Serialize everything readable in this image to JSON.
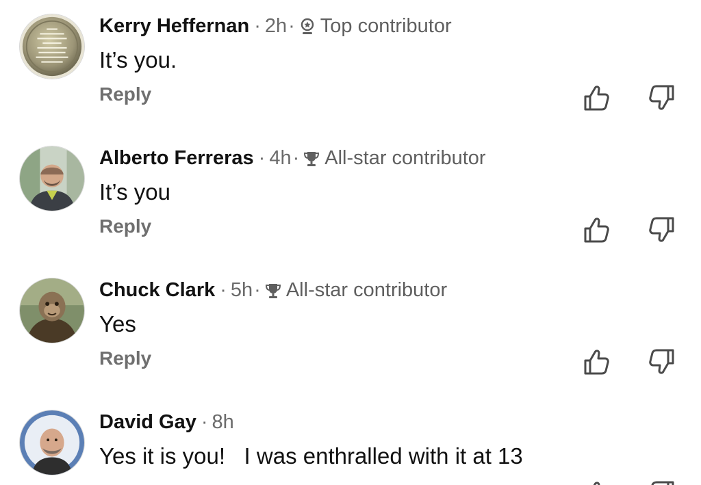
{
  "comments": [
    {
      "author": "Kerry Heffernan",
      "time": "2h",
      "badge": "Top contributor",
      "badge_icon": "top-contributor-icon",
      "text": "It’s you.",
      "reply_label": "Reply",
      "avatar": "coin-avatar"
    },
    {
      "author": "Alberto Ferreras",
      "time": "4h",
      "badge": "All-star contributor",
      "badge_icon": "trophy-icon",
      "text": "It’s you",
      "reply_label": "Reply",
      "avatar": "photo-avatar"
    },
    {
      "author": "Chuck Clark",
      "time": "5h",
      "badge": "All-star contributor",
      "badge_icon": "trophy-icon",
      "text": "Yes",
      "reply_label": "Reply",
      "avatar": "painting-avatar"
    },
    {
      "author": "David Gay",
      "time": "8h",
      "badge": "",
      "text": "Yes it is you!   I was enthralled with it at 13",
      "avatar": "photo-avatar"
    }
  ],
  "colors": {
    "name": "#121212",
    "meta": "#6b6b6b",
    "reply": "#6f6f6f",
    "icon": "#4a4a4a"
  }
}
